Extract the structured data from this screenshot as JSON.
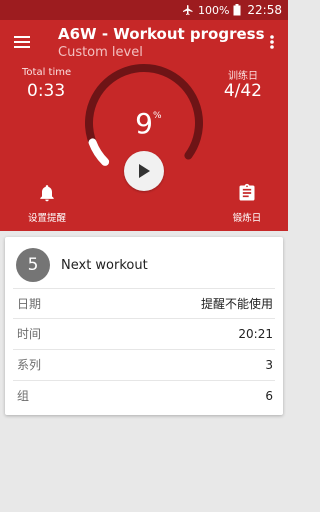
{
  "status_bar": {
    "battery_percent": "100%",
    "time": "22:58",
    "icons": [
      "airplane-mode-icon",
      "battery-icon"
    ]
  },
  "app_bar": {
    "title": "A6W - Workout progress",
    "subtitle": "Custom level",
    "icons": [
      "menu-icon",
      "more-vert-icon"
    ]
  },
  "progress": {
    "total_time_label": "Total time",
    "total_time_value": "0:33",
    "training_day_label": "训练日",
    "training_day_value": "4/42",
    "percent_value": "9",
    "percent_sign": "%",
    "progress_fraction": 0.09
  },
  "actions": {
    "reminder_label": "设置提醒",
    "training_day_label": "锻炼日"
  },
  "next_workout": {
    "day_number": "5",
    "title": "Next workout",
    "rows": [
      {
        "label": "日期",
        "value": "提醒不能使用"
      },
      {
        "label": "时间",
        "value": "20:21"
      },
      {
        "label": "系列",
        "value": "3"
      },
      {
        "label": "组",
        "value": "6"
      }
    ]
  },
  "colors": {
    "primary": "#c62828",
    "status_bar": "#9d1c1f",
    "gauge_track": "#6e1416",
    "gauge_fill": "#ffffff",
    "badge": "#757575"
  }
}
